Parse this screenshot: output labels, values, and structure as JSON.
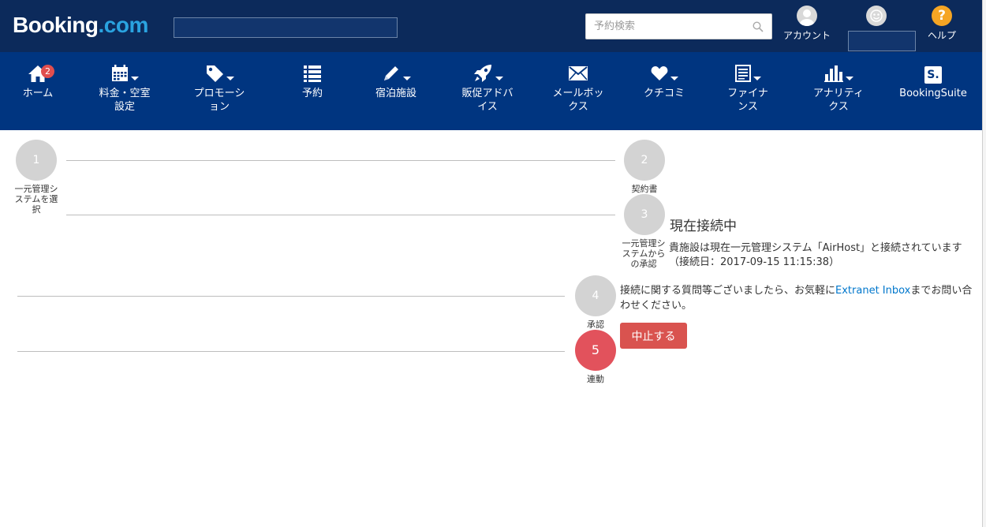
{
  "header": {
    "logo_part1": "Booking",
    "logo_part2": ".com",
    "search_placeholder": "予約検索",
    "account_label": "アカウント",
    "help_label": "ヘルプ",
    "help_symbol": "?"
  },
  "nav": {
    "home": {
      "label": "ホーム",
      "badge": "2",
      "icon": "home-icon"
    },
    "rates": {
      "label": "料金・空室\n設定",
      "icon": "calendar-icon"
    },
    "promotions": {
      "label": "プロモーシ\nョン",
      "icon": "tag-icon"
    },
    "reservations": {
      "label": "予約",
      "icon": "list-icon"
    },
    "property": {
      "label": "宿泊施設",
      "icon": "pencil-icon"
    },
    "opportunities": {
      "label": "販促アドバ\nイス",
      "icon": "rocket-icon"
    },
    "inbox": {
      "label": "メールボッ\nクス",
      "icon": "envelope-icon"
    },
    "reviews": {
      "label": "クチコミ",
      "icon": "heart-icon"
    },
    "finance": {
      "label": "ファイナ\nンス",
      "icon": "document-icon"
    },
    "analytics": {
      "label": "アナリティ\nクス",
      "icon": "bar-chart-icon"
    },
    "bookingsuite": {
      "label": "BookingSuite",
      "icon_text": "S."
    }
  },
  "steps": [
    {
      "number": "1",
      "label": "一元管理シ\nステムを選\n択"
    },
    {
      "number": "2",
      "label": "契約書"
    },
    {
      "number": "3",
      "label": "一元管理シ\nステムから\nの承認"
    },
    {
      "number": "4",
      "label": "承認"
    },
    {
      "number": "5",
      "label": "連動"
    }
  ],
  "status": {
    "title": "現在接続中",
    "text": "貴施設は現在一元管理システム「AirHost」と接続されています（接続日：2017-09-15 11:15:38）",
    "info_before": "接続に関する質問等ございましたら、お気軽に",
    "info_link": "Extranet Inbox",
    "info_after": "までお問い合わせください。",
    "stop_button": "中止する"
  },
  "colors": {
    "header_bg": "#0c2a5b",
    "nav_bg": "#003580",
    "active_step": "#e2525c",
    "inactive_step": "#d3d3d3",
    "stop_button": "#d9534f",
    "link": "#0077cc"
  }
}
